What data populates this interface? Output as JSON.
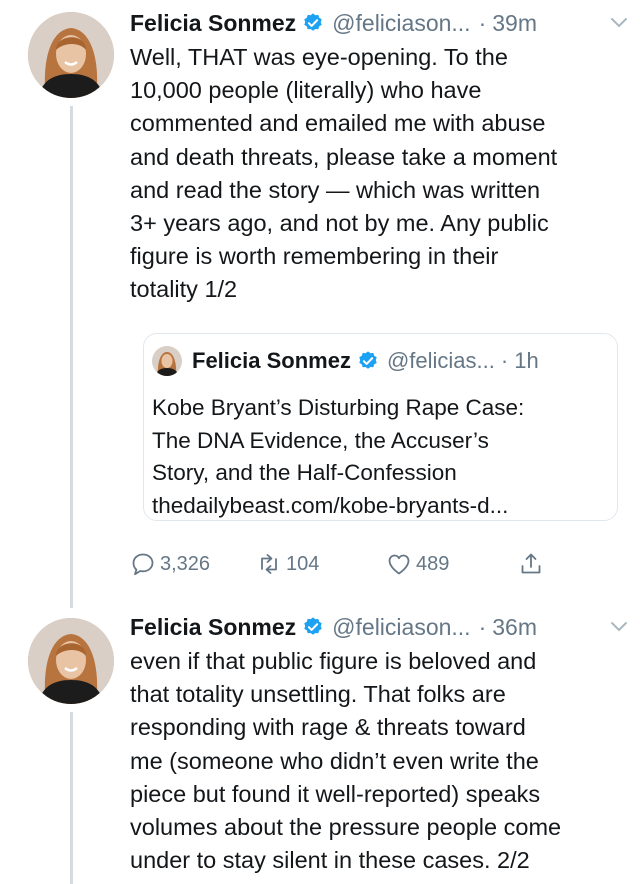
{
  "tweet1": {
    "name": "Felicia Sonmez",
    "handle": "@feliciason...",
    "dot": "·",
    "time": "39m",
    "text": "Well, THAT was eye-opening. To the\n10,000 people (literally) who have\ncommented and emailed me with abuse\nand death threats, please take a moment\nand read the story — which was written\n3+ years ago, and not by me. Any public\nfigure is worth remembering in their\ntotality 1/2",
    "quote": {
      "name": "Felicia Sonmez",
      "handle": "@felicias...",
      "dot": "·",
      "time": "1h",
      "text": "Kobe Bryant’s Disturbing Rape Case:\nThe DNA Evidence, the Accuser’s\nStory, and the Half-Confession\nthedailybeast.com/kobe-bryants-d..."
    },
    "actions": {
      "replies": "3,326",
      "retweets": "104",
      "likes": "489"
    }
  },
  "tweet2": {
    "name": "Felicia Sonmez",
    "handle": "@feliciason...",
    "dot": "·",
    "time": "36m",
    "text": "even if that public figure is beloved and\nthat totality unsettling. That folks are\nresponding with rage & threats toward\nme (someone who didn’t even write the\npiece but found it well-reported) speaks\nvolumes about the pressure people come\nunder to stay silent in these cases. 2/2"
  },
  "colors": {
    "verified": "#1da1f2",
    "secondary_text": "#657786",
    "primary_text": "#14171a",
    "thread_line": "#d6dbe0"
  },
  "icons": [
    "verified-badge-icon",
    "chevron-down-icon",
    "reply-icon",
    "retweet-icon",
    "like-icon",
    "share-icon"
  ]
}
